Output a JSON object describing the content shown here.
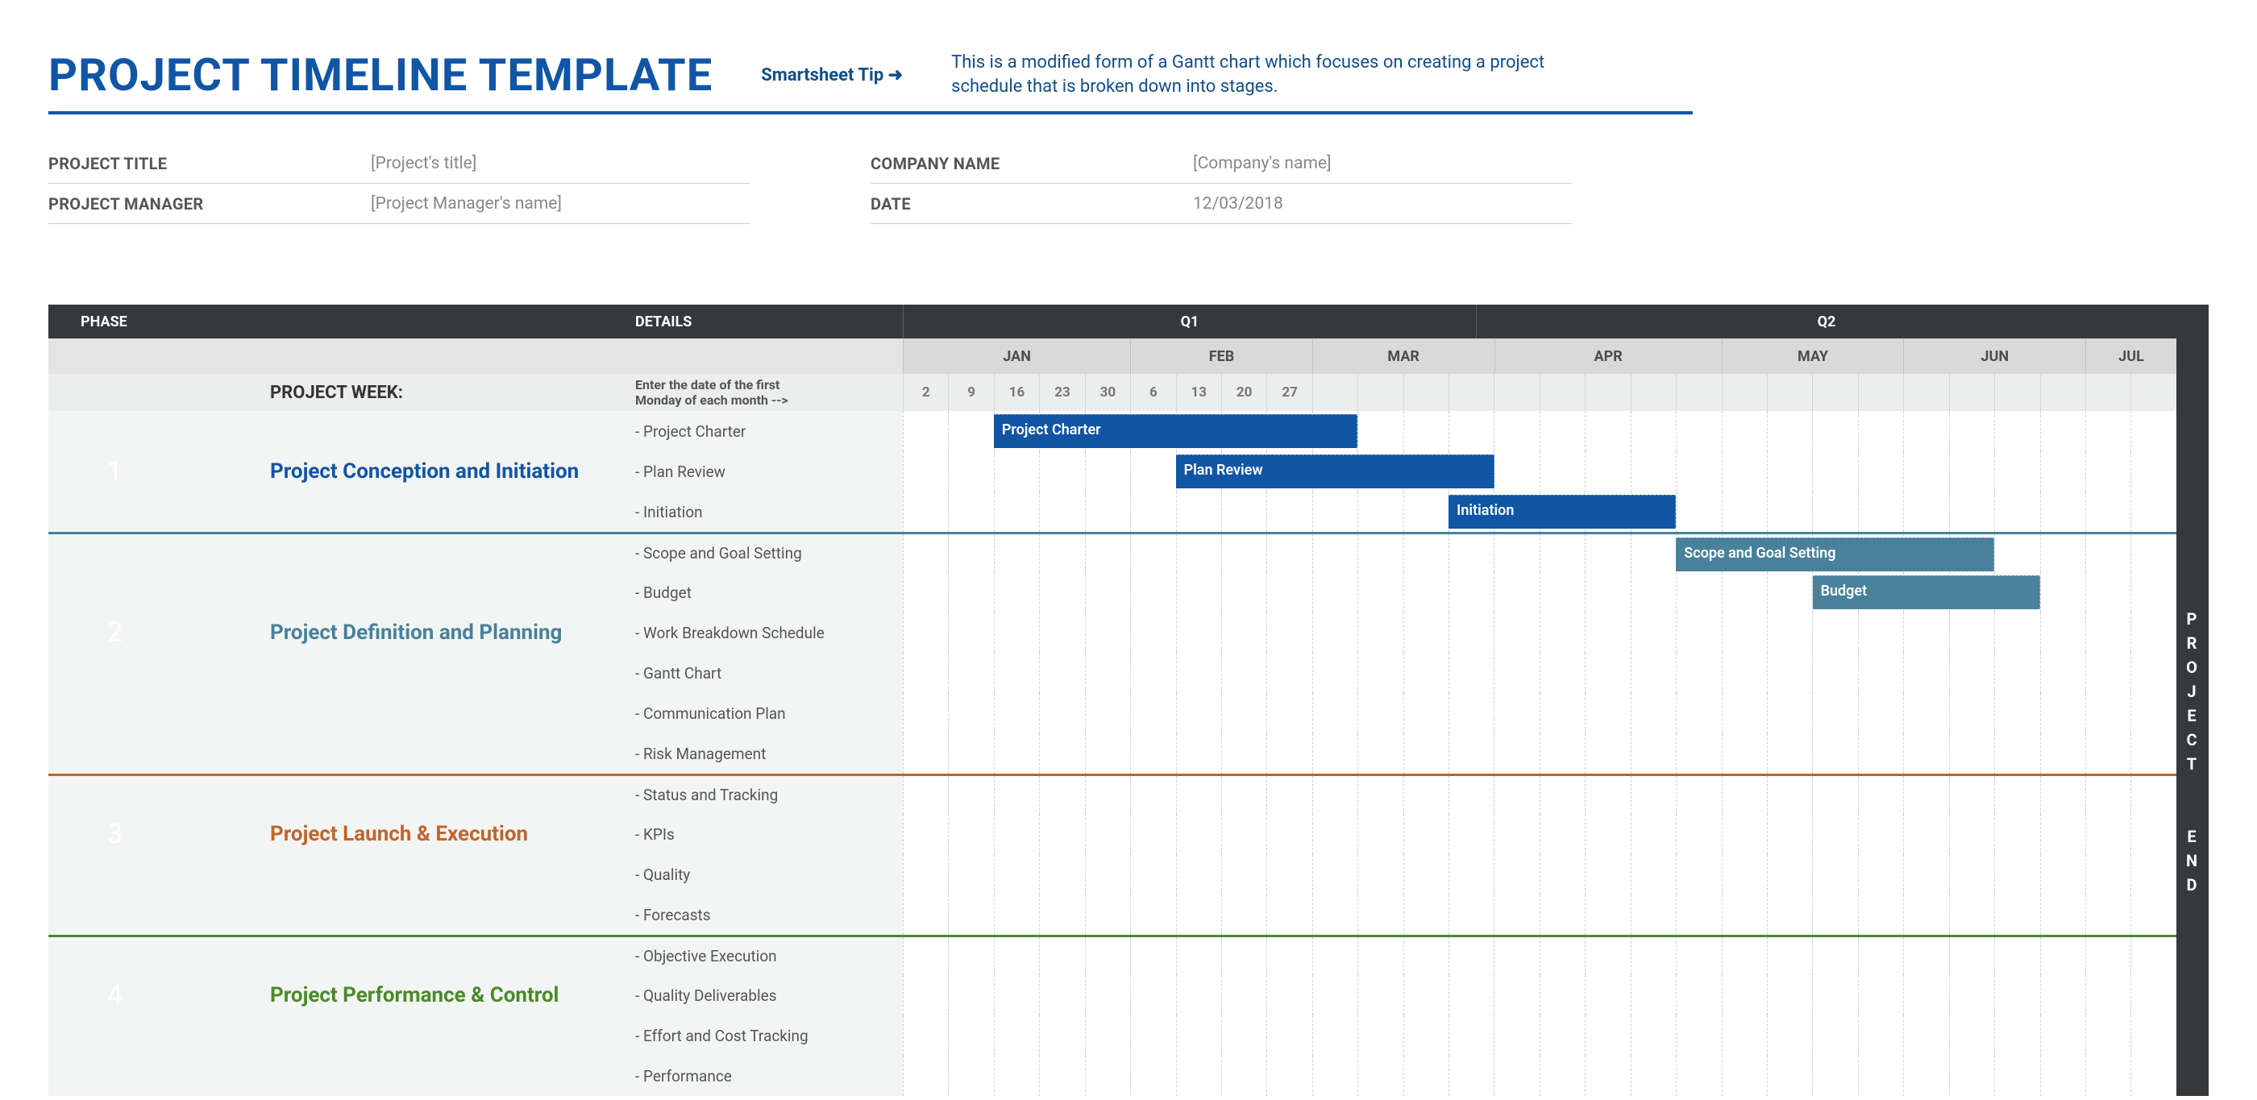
{
  "header": {
    "title": "PROJECT TIMELINE TEMPLATE",
    "tip_link": "Smartsheet Tip ➜",
    "tip_text": "This is a modified form of a Gantt chart which focuses on creating a project schedule that is broken down into stages."
  },
  "meta": {
    "project_title_label": "PROJECT TITLE",
    "project_title_value": "[Project's title]",
    "project_manager_label": "PROJECT MANAGER",
    "project_manager_value": "[Project Manager's name]",
    "company_label": "COMPANY NAME",
    "company_value": "[Company's name]",
    "date_label": "DATE",
    "date_value": "12/03/2018"
  },
  "table": {
    "phase_hdr": "PHASE",
    "details_hdr": "DETAILS",
    "quarters": [
      "Q1",
      "Q2"
    ],
    "months": [
      "JAN",
      "FEB",
      "MAR",
      "APR",
      "MAY",
      "JUN",
      "JUL"
    ],
    "project_week_label": "PROJECT WEEK:",
    "project_week_hint1": "Enter the date of the first",
    "project_week_hint2": "Monday of each month -->",
    "week_numbers": [
      "2",
      "9",
      "16",
      "23",
      "30",
      "6",
      "13",
      "20",
      "27"
    ],
    "project_end": "PROJECT END"
  },
  "phases": [
    {
      "num": "1",
      "name": "Project Conception and Initiation",
      "color": "p1",
      "details": [
        "- Project Charter",
        "- Plan Review",
        "- Initiation"
      ]
    },
    {
      "num": "2",
      "name": "Project Definition and Planning",
      "color": "p2",
      "details": [
        "- Scope and Goal Setting",
        "- Budget",
        "- Work Breakdown Schedule",
        "- Gantt Chart",
        "- Communication Plan",
        "- Risk Management"
      ]
    },
    {
      "num": "3",
      "name": "Project Launch & Execution",
      "color": "p3",
      "details": [
        "- Status and Tracking",
        "- KPIs",
        "- Quality",
        "- Forecasts"
      ]
    },
    {
      "num": "4",
      "name": "Project Performance & Control",
      "color": "p4",
      "details": [
        "- Objective Execution",
        "- Quality Deliverables",
        "- Effort and Cost Tracking",
        "- Performance"
      ]
    }
  ],
  "bars": [
    {
      "phase": 0,
      "row": 0,
      "label": "Project Charter",
      "start_week": 2,
      "span_weeks": 8,
      "color": "p1-bar"
    },
    {
      "phase": 0,
      "row": 1,
      "label": "Plan Review",
      "start_week": 6,
      "span_weeks": 7,
      "color": "p1-bar"
    },
    {
      "phase": 0,
      "row": 2,
      "label": "Initiation",
      "start_week": 12,
      "span_weeks": 5,
      "color": "p1-bar"
    },
    {
      "phase": 1,
      "row": 0,
      "label": "Scope and Goal Setting",
      "start_week": 17,
      "span_weeks": 7,
      "color": "p2-bar"
    },
    {
      "phase": 1,
      "row": 1,
      "label": "Budget",
      "start_week": 20,
      "span_weeks": 5,
      "color": "p2-bar"
    }
  ],
  "chart_data": {
    "type": "gantt",
    "title": "Project Timeline Template",
    "x_axis": {
      "quarters": [
        {
          "label": "Q1",
          "months": [
            "JAN",
            "FEB",
            "MAR"
          ]
        },
        {
          "label": "Q2",
          "months": [
            "APR",
            "MAY",
            "JUN",
            "JUL"
          ]
        }
      ],
      "weeks_visible_day_numbers": [
        2,
        9,
        16,
        23,
        30,
        6,
        13,
        20,
        27
      ]
    },
    "series": [
      {
        "phase": 1,
        "task": "Project Charter",
        "start_week_index": 2,
        "duration_weeks": 8
      },
      {
        "phase": 1,
        "task": "Plan Review",
        "start_week_index": 6,
        "duration_weeks": 7
      },
      {
        "phase": 1,
        "task": "Initiation",
        "start_week_index": 12,
        "duration_weeks": 5
      },
      {
        "phase": 2,
        "task": "Scope and Goal Setting",
        "start_week_index": 17,
        "duration_weeks": 7
      },
      {
        "phase": 2,
        "task": "Budget",
        "start_week_index": 20,
        "duration_weeks": 5
      }
    ]
  }
}
